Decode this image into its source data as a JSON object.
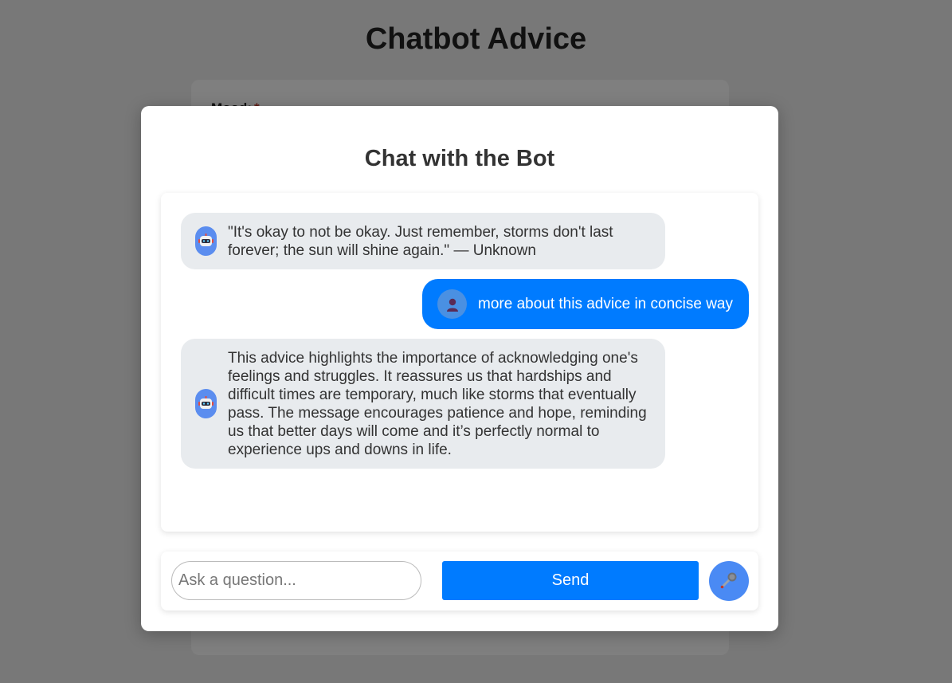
{
  "page": {
    "title": "Chatbot Advice",
    "form_field_label": "Mood:",
    "required_marker": "*"
  },
  "modal": {
    "title": "Chat with the Bot"
  },
  "messages": [
    {
      "sender": "bot",
      "icon": "robot-icon",
      "text": "\"It's okay to not be okay. Just remember, storms don't last forever; the sun will shine again.\" — Unknown"
    },
    {
      "sender": "user",
      "icon": "user-icon",
      "text": "more about this advice in concise way"
    },
    {
      "sender": "bot",
      "icon": "robot-icon",
      "text": "This advice highlights the importance of acknowledging one's feelings and struggles. It reassures us that hardships and difficult times are temporary, much like storms that eventually pass. The message encourages patience and hope, reminding us that better days will come and it’s perfectly normal to experience ups and downs in life."
    }
  ],
  "input": {
    "placeholder": "Ask a question...",
    "value": ""
  },
  "send_label": "Send",
  "mic_icon": "microphone-icon",
  "colors": {
    "accent": "#007bff",
    "bot_bubble": "#e8ebee",
    "avatar": "#4a90e2"
  }
}
